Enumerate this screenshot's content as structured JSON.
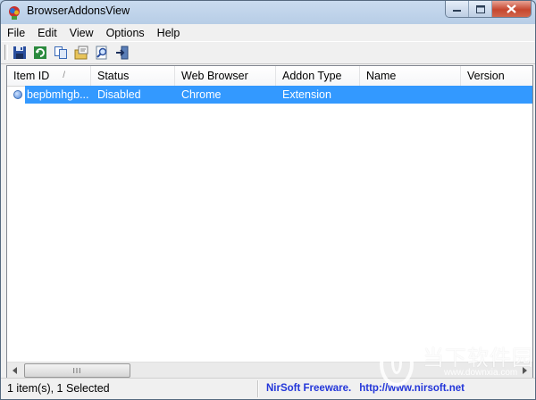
{
  "window": {
    "title": "BrowserAddonsView"
  },
  "menu": [
    "File",
    "Edit",
    "View",
    "Options",
    "Help"
  ],
  "toolbar": {
    "buttons": [
      {
        "name": "save-icon"
      },
      {
        "name": "refresh-icon"
      },
      {
        "name": "copy-icon"
      },
      {
        "name": "properties-icon"
      },
      {
        "name": "find-icon"
      },
      {
        "name": "exit-icon"
      }
    ]
  },
  "list": {
    "columns": [
      "Item ID",
      "Status",
      "Web Browser",
      "Addon Type",
      "Name",
      "Version"
    ],
    "sort_indicator": "/",
    "rows": [
      {
        "item_id": "bepbmhgb...",
        "status": "Disabled",
        "web_browser": "Chrome",
        "addon_type": "Extension",
        "name": "",
        "version": "",
        "selected": true
      }
    ],
    "scroll_thumb_grip": "III"
  },
  "status": {
    "items": "1 item(s), 1 Selected",
    "vendor": "NirSoft Freeware.",
    "url": "http://www.nirsoft.net"
  },
  "watermark": {
    "text": "当下软件园",
    "url": "www.downxia.com"
  },
  "colors": {
    "selection": "#3399ff",
    "link": "#2336d9",
    "title_bg": "#b7cde6"
  }
}
